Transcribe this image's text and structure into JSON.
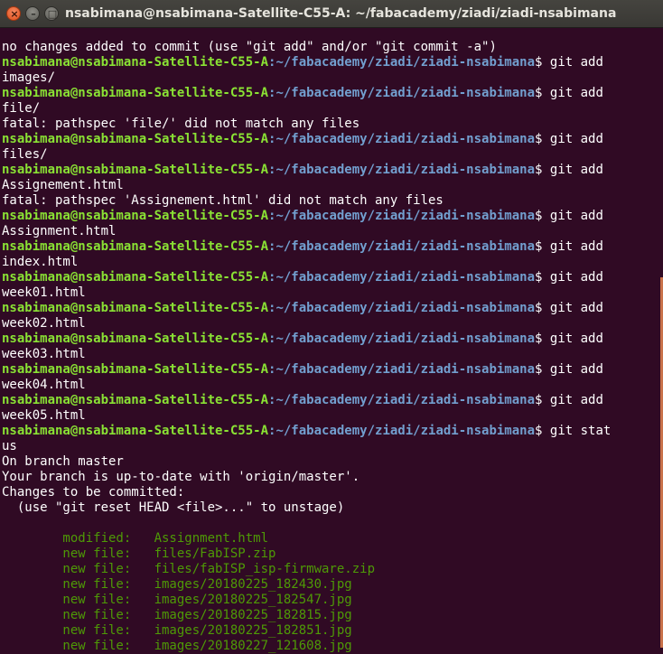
{
  "window": {
    "title": "nsabimana@nsabimana-Satellite-C55-A: ~/fabacademy/ziadi/ziadi-nsabimana",
    "close_glyph": "×",
    "minimize_glyph": "–",
    "maximize_glyph": "□"
  },
  "prompt": {
    "user": "nsabimana@nsabimana-Satellite-C55-A",
    "path": ":~/fabacademy/ziadi/ziadi-nsabimana",
    "symbol": "$"
  },
  "colors": {
    "background": "#300a24",
    "prompt_user": "#8ae234",
    "prompt_path": "#729fcf",
    "staged_file": "#4e9a06",
    "text": "#ffffff"
  },
  "lines": [
    {
      "type": "out",
      "text": "no changes added to commit (use \"git add\" and/or \"git commit -a\")"
    },
    {
      "type": "prompt",
      "cmd": " git add"
    },
    {
      "type": "out",
      "text": "images/"
    },
    {
      "type": "prompt",
      "cmd": " git add"
    },
    {
      "type": "out",
      "text": "file/"
    },
    {
      "type": "out",
      "text": "fatal: pathspec 'file/' did not match any files"
    },
    {
      "type": "prompt",
      "cmd": " git add"
    },
    {
      "type": "out",
      "text": "files/"
    },
    {
      "type": "prompt",
      "cmd": " git add"
    },
    {
      "type": "out",
      "text": "Assignement.html"
    },
    {
      "type": "out",
      "text": "fatal: pathspec 'Assignement.html' did not match any files"
    },
    {
      "type": "prompt",
      "cmd": " git add"
    },
    {
      "type": "out",
      "text": "Assignment.html"
    },
    {
      "type": "prompt",
      "cmd": " git add"
    },
    {
      "type": "out",
      "text": "index.html"
    },
    {
      "type": "prompt",
      "cmd": " git add"
    },
    {
      "type": "out",
      "text": "week01.html"
    },
    {
      "type": "prompt",
      "cmd": " git add"
    },
    {
      "type": "out",
      "text": "week02.html"
    },
    {
      "type": "prompt",
      "cmd": " git add"
    },
    {
      "type": "out",
      "text": "week03.html"
    },
    {
      "type": "prompt",
      "cmd": " git add"
    },
    {
      "type": "out",
      "text": "week04.html"
    },
    {
      "type": "prompt",
      "cmd": " git add"
    },
    {
      "type": "out",
      "text": "week05.html"
    },
    {
      "type": "prompt",
      "cmd": " git stat"
    },
    {
      "type": "out",
      "text": "us"
    },
    {
      "type": "out",
      "text": "On branch master"
    },
    {
      "type": "out",
      "text": "Your branch is up-to-date with 'origin/master'."
    },
    {
      "type": "out",
      "text": "Changes to be committed:"
    },
    {
      "type": "out",
      "text": "  (use \"git reset HEAD <file>...\" to unstage)"
    },
    {
      "type": "out",
      "text": ""
    },
    {
      "type": "green",
      "text": "        modified:   Assignment.html"
    },
    {
      "type": "green",
      "text": "        new file:   files/FabISP.zip"
    },
    {
      "type": "green",
      "text": "        new file:   files/fabISP_isp-firmware.zip"
    },
    {
      "type": "green",
      "text": "        new file:   images/20180225_182430.jpg"
    },
    {
      "type": "green",
      "text": "        new file:   images/20180225_182547.jpg"
    },
    {
      "type": "green",
      "text": "        new file:   images/20180225_182815.jpg"
    },
    {
      "type": "green",
      "text": "        new file:   images/20180225_182851.jpg"
    },
    {
      "type": "green",
      "text": "        new file:   images/20180227_121608.jpg"
    }
  ]
}
